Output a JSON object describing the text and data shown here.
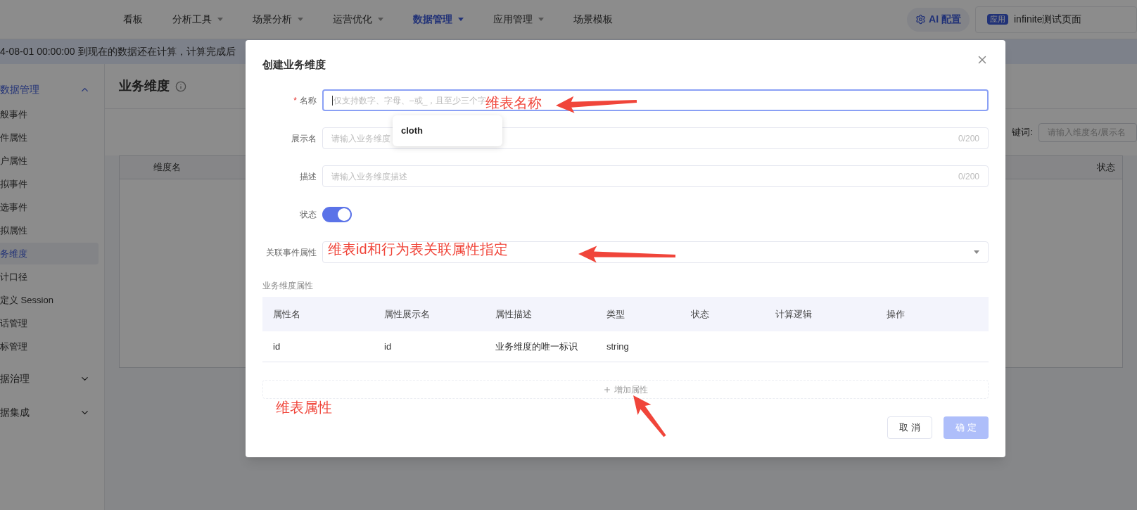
{
  "top_nav": {
    "items": [
      {
        "label": "看板",
        "dropdown": false,
        "selected": false
      },
      {
        "label": "分析工具",
        "dropdown": true,
        "selected": false
      },
      {
        "label": "场景分析",
        "dropdown": true,
        "selected": false
      },
      {
        "label": "运营优化",
        "dropdown": true,
        "selected": false
      },
      {
        "label": "数据管理",
        "dropdown": true,
        "selected": true
      },
      {
        "label": "应用管理",
        "dropdown": true,
        "selected": false
      },
      {
        "label": "场景模板",
        "dropdown": false,
        "selected": false
      }
    ],
    "ai_button": "AI 配置",
    "app_badge": "应用",
    "app_name": "infinite测试页面"
  },
  "banner": "4-08-01 00:00:00 到现在的数据还在计算，计算完成后",
  "sidebar": {
    "items": [
      {
        "label": "数据管理",
        "expanded": true,
        "children": [
          {
            "label": "般事件",
            "selected": false
          },
          {
            "label": "件属性",
            "selected": false
          },
          {
            "label": "户属性",
            "selected": false
          },
          {
            "label": "拟事件",
            "selected": false
          },
          {
            "label": "选事件",
            "selected": false
          },
          {
            "label": "拟属性",
            "selected": false
          },
          {
            "label": "务维度",
            "selected": true
          },
          {
            "label": "计口径",
            "selected": false
          },
          {
            "label": "定义 Session",
            "selected": false
          },
          {
            "label": "话管理",
            "selected": false
          },
          {
            "label": "标管理",
            "selected": false
          }
        ]
      },
      {
        "label": "据治理",
        "expanded": false
      },
      {
        "label": "据集成",
        "expanded": false
      }
    ]
  },
  "page": {
    "title": "业务维度",
    "search_label": "键词:",
    "search_placeholder": "请输入维度名/展示名",
    "table": {
      "columns": [
        "维度名",
        "状态"
      ]
    }
  },
  "dialog": {
    "title": "创建业务维度",
    "fields": [
      {
        "label": "名称",
        "kind": "text",
        "required_mark": "*",
        "focused": true,
        "placeholder": "仅支持数字、字母、–或_，且至少三个字"
      },
      {
        "label": "展示名",
        "kind": "text",
        "focused": false,
        "placeholder": "请输入业务维度",
        "count": "0/200"
      },
      {
        "label": "描述",
        "kind": "text",
        "focused": false,
        "placeholder": "请输入业务维度描述",
        "count": "0/200"
      },
      {
        "label": "状态",
        "kind": "switch",
        "on": true
      },
      {
        "label": "关联事件属性",
        "kind": "select"
      }
    ],
    "suggestion": "cloth",
    "section_title": "业务维度属性",
    "table": {
      "columns": [
        "属性名",
        "属性展示名",
        "属性描述",
        "类型",
        "状态",
        "计算逻辑",
        "操作"
      ],
      "rows": [
        [
          "id",
          "id",
          "业务维度的唯一标识",
          "string"
        ]
      ]
    },
    "add_button": "增加属性",
    "buttons": [
      {
        "label": "取 消",
        "kind": "default",
        "disabled": false
      },
      {
        "label": "确 定",
        "kind": "primary",
        "disabled": true
      }
    ]
  },
  "annotations": [
    {
      "text": "维表名称",
      "kind": "name"
    },
    {
      "text": "维表id和行为表关联属性指定",
      "kind": "link"
    },
    {
      "text": "维表属性",
      "kind": "attrs"
    }
  ]
}
